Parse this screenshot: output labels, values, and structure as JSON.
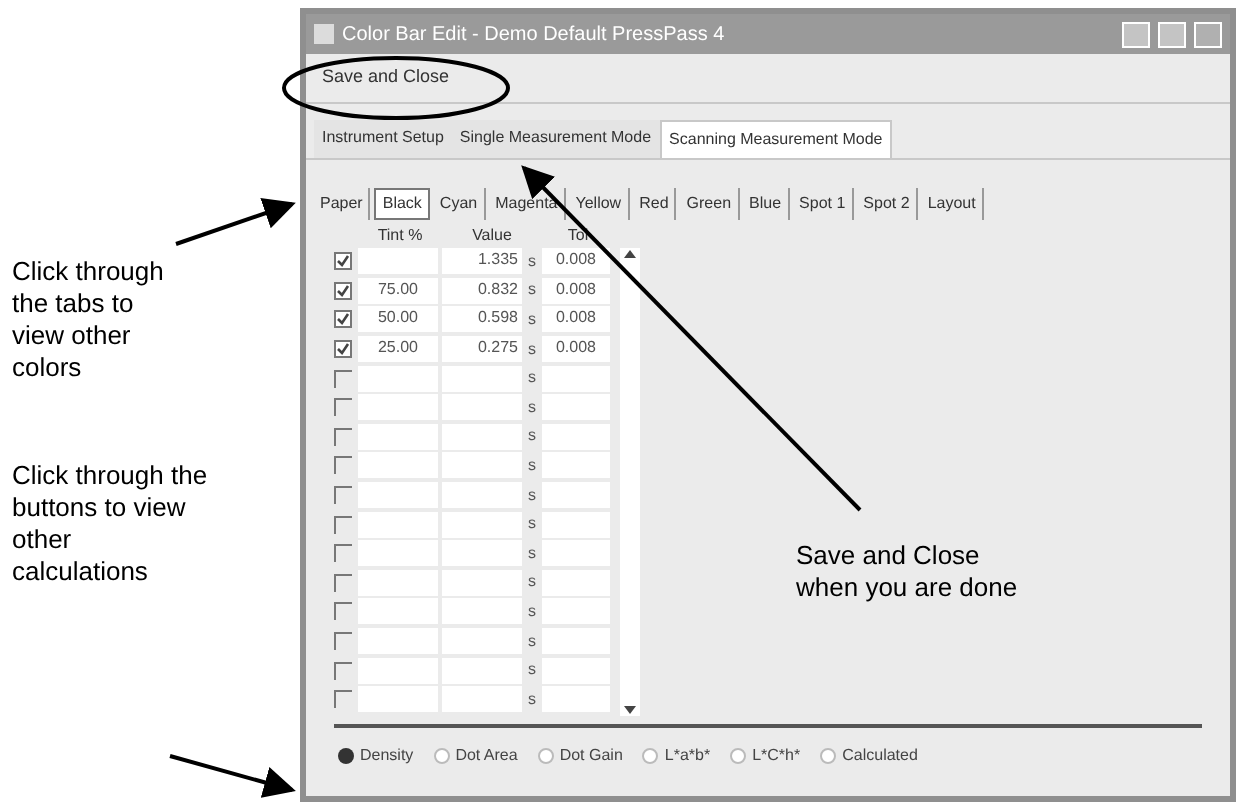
{
  "window": {
    "title": "Color Bar Edit - Demo Default PressPass 4"
  },
  "menu": [
    "Save and Close"
  ],
  "mode_tabs": [
    {
      "label": "Instrument Setup",
      "selected": false
    },
    {
      "label": "Single Measurement Mode",
      "selected": false
    },
    {
      "label": "Scanning Measurement Mode",
      "selected": true
    }
  ],
  "color_tabs": [
    {
      "label": "Paper",
      "selected": false
    },
    {
      "label": "Black",
      "selected": true
    },
    {
      "label": "Cyan",
      "selected": false
    },
    {
      "label": "Magenta",
      "selected": false
    },
    {
      "label": "Yellow",
      "selected": false
    },
    {
      "label": "Red",
      "selected": false
    },
    {
      "label": "Green",
      "selected": false
    },
    {
      "label": "Blue",
      "selected": false
    },
    {
      "label": "Spot 1",
      "selected": false
    },
    {
      "label": "Spot 2",
      "selected": false
    },
    {
      "label": "Layout",
      "selected": false
    }
  ],
  "table": {
    "columns": [
      "Tint %",
      "Value",
      "Tol"
    ],
    "rows": [
      {
        "checked": true,
        "tint": "",
        "value": "1.335",
        "unit": "s",
        "tol": "0.008"
      },
      {
        "checked": true,
        "tint": "75.00",
        "value": "0.832",
        "unit": "s",
        "tol": "0.008"
      },
      {
        "checked": true,
        "tint": "50.00",
        "value": "0.598",
        "unit": "s",
        "tol": "0.008"
      },
      {
        "checked": true,
        "tint": "25.00",
        "value": "0.275",
        "unit": "s",
        "tol": "0.008"
      },
      {
        "checked": false,
        "unit": "s"
      },
      {
        "checked": false,
        "unit": "s"
      },
      {
        "checked": false,
        "unit": "s"
      },
      {
        "checked": false,
        "unit": "s"
      },
      {
        "checked": false,
        "unit": "s"
      },
      {
        "checked": false,
        "unit": "s"
      },
      {
        "checked": false,
        "unit": "s"
      },
      {
        "checked": false,
        "unit": "s"
      },
      {
        "checked": false,
        "unit": "s"
      },
      {
        "checked": false,
        "unit": "s"
      },
      {
        "checked": false,
        "unit": "s"
      },
      {
        "checked": false,
        "unit": "s"
      }
    ]
  },
  "calculations": [
    {
      "label": "Density",
      "selected": true
    },
    {
      "label": "Dot Area",
      "selected": false
    },
    {
      "label": "Dot Gain",
      "selected": false
    },
    {
      "label": "L*a*b*",
      "selected": false
    },
    {
      "label": "L*C*h*",
      "selected": false
    },
    {
      "label": "Calculated",
      "selected": false
    }
  ],
  "annotations": {
    "tabs_note": "Click through the tabs to view other colors",
    "buttons_note": "Click through the buttons to view other calculations",
    "save_note": "Save and Close when you are done"
  }
}
